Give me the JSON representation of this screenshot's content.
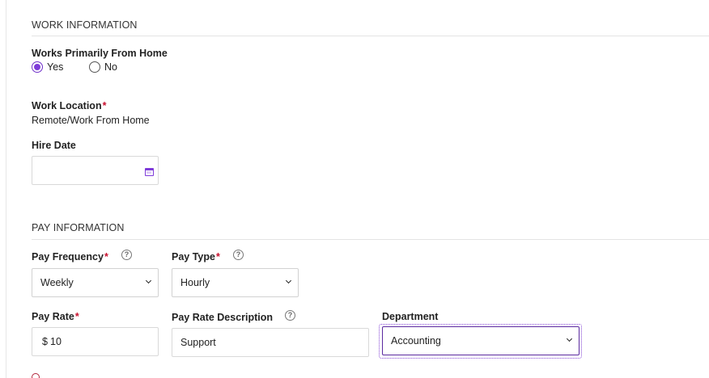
{
  "work_info": {
    "section_title": "WORK INFORMATION",
    "works_from_home": {
      "label": "Works Primarily From Home",
      "options": [
        {
          "label": "Yes",
          "checked": true
        },
        {
          "label": "No",
          "checked": false
        }
      ]
    },
    "work_location": {
      "label": "Work Location",
      "required_mark": "*",
      "value": "Remote/Work From Home"
    },
    "hire_date": {
      "label": "Hire Date",
      "value": "",
      "icon": "calendar-icon"
    }
  },
  "pay_info": {
    "section_title": "PAY INFORMATION",
    "pay_frequency": {
      "label": "Pay Frequency",
      "required_mark": "*",
      "value": "Weekly",
      "help": "?"
    },
    "pay_type": {
      "label": "Pay Type",
      "required_mark": "*",
      "value": "Hourly",
      "help": "?"
    },
    "pay_rate": {
      "label": "Pay Rate",
      "required_mark": "*",
      "currency": "$",
      "value": "10"
    },
    "pay_rate_description": {
      "label": "Pay Rate Description",
      "value": "Support",
      "help": "?"
    },
    "department": {
      "label": "Department",
      "value": "Accounting"
    }
  },
  "colors": {
    "accent": "#7e3bd9",
    "required": "#c8102e",
    "focus": "#5b2aa0"
  }
}
